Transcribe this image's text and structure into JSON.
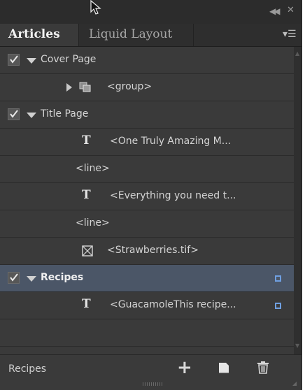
{
  "tabs": [
    {
      "label": "Articles",
      "active": true
    },
    {
      "label": "Liquid Layout",
      "active": false
    }
  ],
  "rows": [
    {
      "type": "article",
      "label": "Cover Page",
      "checked": true,
      "expanded": true,
      "selected": false
    },
    {
      "type": "group",
      "label": "<group>"
    },
    {
      "type": "article",
      "label": "Title Page",
      "checked": true,
      "expanded": true,
      "selected": false
    },
    {
      "type": "text",
      "label": "<One Truly Amazing M..."
    },
    {
      "type": "line",
      "label": "<line>"
    },
    {
      "type": "text",
      "label": "<Everything you need t..."
    },
    {
      "type": "line",
      "label": "<line>"
    },
    {
      "type": "image",
      "label": "<Strawberries.tif>"
    },
    {
      "type": "article",
      "label": "Recipes",
      "checked": true,
      "expanded": true,
      "selected": true,
      "synced": true
    },
    {
      "type": "text",
      "label": "<GuacamoleThis recipe...",
      "synced": true
    }
  ],
  "footer": {
    "label": "Recipes"
  },
  "icons": {
    "cursor": "mouse-pointer-icon",
    "collapse": "double-chevron-icon",
    "close": "close-icon",
    "panel_menu": "panel-menu-icon",
    "add": "plus-icon",
    "new": "new-item-icon",
    "trash": "trash-icon",
    "checkbox": "checkmark-icon",
    "text_frame": "text-frame-icon",
    "group": "group-icon",
    "image": "image-frame-icon"
  },
  "colors": {
    "panel_bg": "#3a3a3a",
    "selected_row": "#4b5667",
    "sync_indicator": "#6f9fe0"
  }
}
